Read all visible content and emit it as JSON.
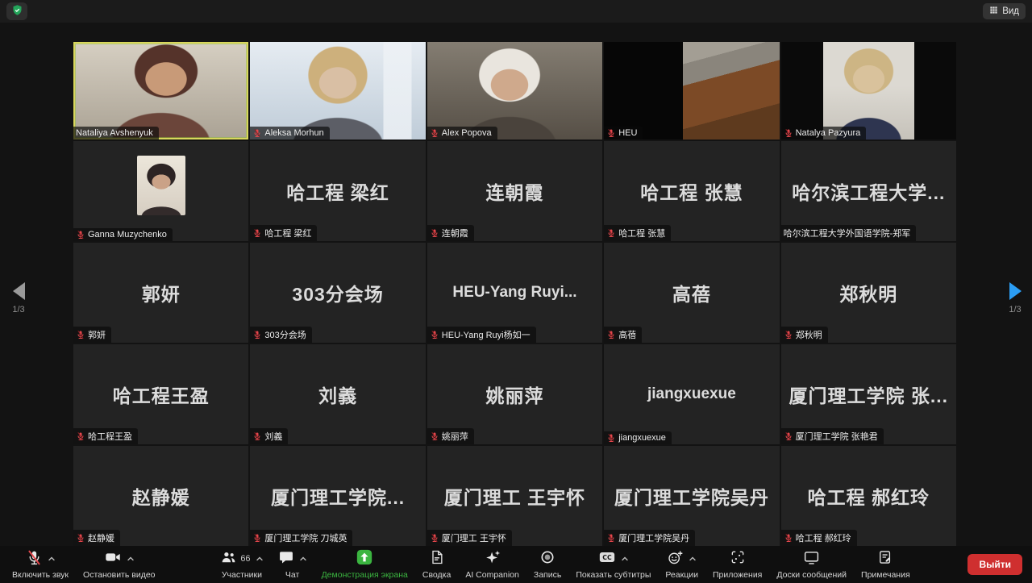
{
  "topbar": {
    "view_label": "Вид",
    "security_icon": "shield-check-icon"
  },
  "pagination": {
    "left_label": "1/3",
    "right_label": "1/3"
  },
  "colors": {
    "share_green": "#3bb540",
    "leave_red": "#cf2f2f",
    "muted_mic_red": "#e5484d",
    "active_border_yellow": "#d9d75c",
    "next_page_arrow_blue": "#2b9df4"
  },
  "participants": [
    {
      "label": "Nataliya Avshenyuk",
      "type": "video",
      "video": "v1",
      "muted": false,
      "active": true
    },
    {
      "label": "Aleksa Morhun",
      "type": "video",
      "video": "v2",
      "muted": true,
      "active": false
    },
    {
      "label": "Alex Popova",
      "type": "video",
      "video": "v3",
      "muted": true,
      "active": false
    },
    {
      "label": "HEU",
      "type": "video",
      "video": "v4",
      "muted": true,
      "active": false
    },
    {
      "label": "Natalya Pazyura",
      "type": "video",
      "video": "v5",
      "muted": true,
      "active": false
    },
    {
      "label": "Ganna Muzychenko",
      "type": "avatar",
      "muted": true,
      "active": false
    },
    {
      "label": "哈工程 梁红",
      "type": "text",
      "center": "哈工程 梁红",
      "muted": true,
      "active": false
    },
    {
      "label": "连朝霞",
      "type": "text",
      "center": "连朝霞",
      "muted": true,
      "active": false
    },
    {
      "label": "哈工程 张慧",
      "type": "text",
      "center": "哈工程 张慧",
      "muted": true,
      "active": false
    },
    {
      "label": "哈尔滨工程大学外国语学院-郑军",
      "type": "text",
      "center": "哈尔滨工程大学...",
      "muted": false,
      "active": false
    },
    {
      "label": "郭妍",
      "type": "text",
      "center": "郭妍",
      "muted": true,
      "active": false
    },
    {
      "label": "303分会场",
      "type": "text",
      "center": "303分会场",
      "muted": true,
      "active": false
    },
    {
      "label": "HEU-Yang Ruyi杨如一",
      "type": "text",
      "center": "HEU-Yang  Ruyi...",
      "latin": true,
      "muted": true,
      "active": false
    },
    {
      "label": "高蓓",
      "type": "text",
      "center": "高蓓",
      "muted": true,
      "active": false
    },
    {
      "label": "郑秋明",
      "type": "text",
      "center": "郑秋明",
      "muted": true,
      "active": false
    },
    {
      "label": "哈工程王盈",
      "type": "text",
      "center": "哈工程王盈",
      "muted": true,
      "active": false
    },
    {
      "label": "刘義",
      "type": "text",
      "center": "刘義",
      "muted": true,
      "active": false
    },
    {
      "label": "姚丽萍",
      "type": "text",
      "center": "姚丽萍",
      "muted": true,
      "active": false
    },
    {
      "label": "jiangxuexue",
      "type": "text",
      "center": "jiangxuexue",
      "latin": true,
      "muted": true,
      "active": false
    },
    {
      "label": "厦门理工学院 张艳君",
      "type": "text",
      "center": "厦门理工学院 张...",
      "muted": true,
      "active": false
    },
    {
      "label": "赵静媛",
      "type": "text",
      "center": "赵静媛",
      "muted": true,
      "active": false
    },
    {
      "label": "厦门理工学院 刀城英",
      "type": "text",
      "center": "厦门理工学院...",
      "muted": true,
      "active": false
    },
    {
      "label": "厦门理工 王宇怀",
      "type": "text",
      "center": "厦门理工 王宇怀",
      "muted": true,
      "active": false
    },
    {
      "label": "厦门理工学院吴丹",
      "type": "text",
      "center": "厦门理工学院吴丹",
      "muted": true,
      "active": false
    },
    {
      "label": "哈工程 郝红玲",
      "type": "text",
      "center": "哈工程 郝红玲",
      "muted": true,
      "active": false
    }
  ],
  "toolbar": {
    "participants_count": "66",
    "leave_label": "Выйти",
    "groups": {
      "left": [
        {
          "name": "unmute",
          "label": "Включить звук",
          "icon": "mic-muted-icon",
          "caret": true
        },
        {
          "name": "stop-video",
          "label": "Остановить видео",
          "icon": "camera-icon",
          "caret": true
        }
      ],
      "center": [
        {
          "name": "participants",
          "label": "Участники",
          "icon": "participants-icon",
          "caret": true,
          "badge": "66"
        },
        {
          "name": "chat",
          "label": "Чат",
          "icon": "chat-icon",
          "caret": true
        },
        {
          "name": "share-screen",
          "label": "Демонстрация экрана",
          "icon": "share-screen-icon",
          "green": true
        },
        {
          "name": "summary",
          "label": "Сводка",
          "icon": "document-icon"
        },
        {
          "name": "ai-companion",
          "label": "AI Companion",
          "icon": "sparkle-icon"
        },
        {
          "name": "record",
          "label": "Запись",
          "icon": "record-icon"
        },
        {
          "name": "captions",
          "label": "Показать субтитры",
          "icon": "cc-icon",
          "caret": true
        },
        {
          "name": "reactions",
          "label": "Реакции",
          "icon": "smiley-icon",
          "caret": true
        },
        {
          "name": "apps",
          "label": "Приложения",
          "icon": "apps-icon"
        },
        {
          "name": "whiteboards",
          "label": "Доски сообщений",
          "icon": "whiteboard-icon"
        },
        {
          "name": "notes",
          "label": "Примечания",
          "icon": "notes-icon"
        }
      ]
    }
  }
}
